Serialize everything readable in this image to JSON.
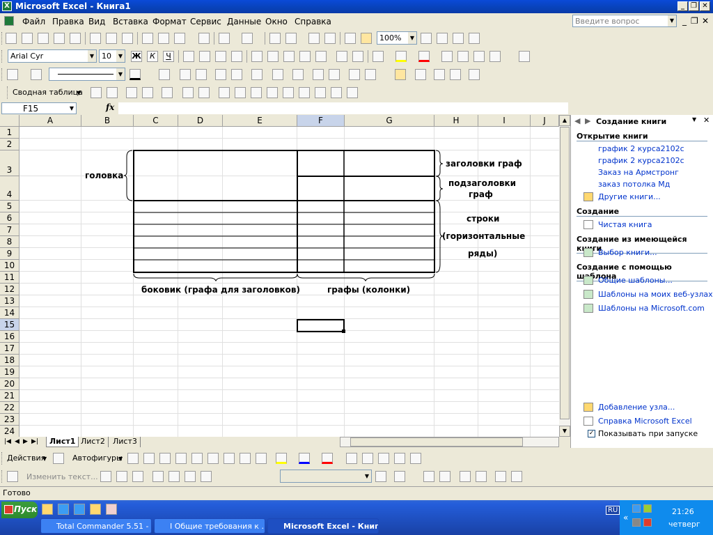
{
  "window": {
    "title": "Microsoft Excel - Книга1",
    "title_icon": "X"
  },
  "menu": [
    "Файл",
    "Правка",
    "Вид",
    "Вставка",
    "Формат",
    "Сервис",
    "Данные",
    "Окно",
    "Справка"
  ],
  "ask_placeholder": "Введите вопрос",
  "formatting": {
    "font": "Arial Cyr",
    "size": "10",
    "zoom": "100%"
  },
  "pivot_label": "Сводная таблица",
  "namebox": "F15",
  "fx": "fx",
  "columns": [
    "A",
    "B",
    "C",
    "D",
    "E",
    "F",
    "G",
    "H",
    "I",
    "J"
  ],
  "rows": [
    "1",
    "2",
    "3",
    "4",
    "5",
    "6",
    "7",
    "8",
    "9",
    "10",
    "11",
    "12",
    "13",
    "14",
    "15",
    "16",
    "17",
    "18",
    "19",
    "20",
    "21",
    "22",
    "23",
    "24"
  ],
  "annotations": {
    "golovka": "головка",
    "zagolovki": "заголовки граф",
    "podzag1": "подзаголовки",
    "podzag2": "граф",
    "stroki1": "строки",
    "stroki2": "(горизонтальные",
    "stroki3": "ряды)",
    "bokovik": "боковик (графа для заголовков)",
    "grafy": "графы (колонки)"
  },
  "sheets": [
    "Лист1",
    "Лист2",
    "Лист3"
  ],
  "taskpane": {
    "title": "Создание книги",
    "open_header": "Открытие книги",
    "recent": [
      "график 2 курса2102с",
      "график 2 курса2102с",
      "Заказ на Армстронг",
      "заказ потолка Мд"
    ],
    "more": "Другие книги...",
    "create_header": "Создание",
    "blank": "Чистая книга",
    "from_existing_header": "Создание из имеющейся книги",
    "choose": "Выбор книги...",
    "template_header": "Создание с помощью шаблона",
    "templates": [
      "Общие шаблоны...",
      "Шаблоны на моих веб-узлах...",
      "Шаблоны на Microsoft.com"
    ],
    "add_node": "Добавление узла...",
    "help": "Справка Microsoft Excel",
    "show_on_start": "Показывать при запуске"
  },
  "draw": {
    "actions": "Действия",
    "autoshapes": "Автофигуры"
  },
  "wordart_edit": "Изменить текст...",
  "status": "Готово",
  "taskbar": {
    "start": "Пуск",
    "buttons": [
      "Total Commander 5.51 - ...",
      "I Общие требования к ...",
      "Microsoft Excel - Книг..."
    ],
    "lang": "RU",
    "time": "21:26",
    "day": "четверг"
  },
  "colors": {
    "title": "#0a4ad8",
    "link": "#0033cc",
    "selected_header": "#c8d4ea"
  }
}
